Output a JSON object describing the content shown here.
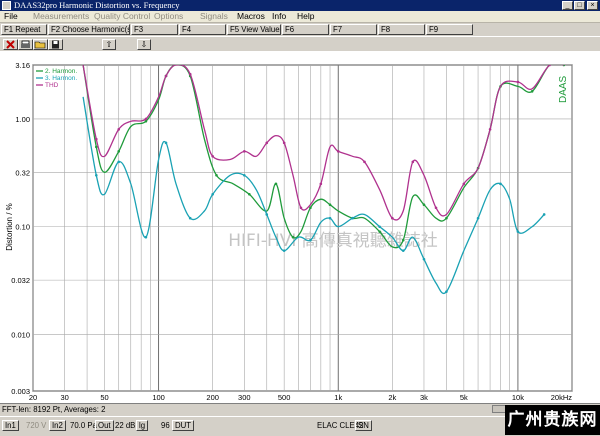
{
  "window": {
    "title": "DAAS32pro  Harmonic Distortion vs. Frequency",
    "min": "_",
    "max": "□",
    "close": "×"
  },
  "menu": [
    {
      "label": "File",
      "dim": false
    },
    {
      "label": "Measurements",
      "dim": true
    },
    {
      "label": "Quality Control",
      "dim": true
    },
    {
      "label": "Options",
      "dim": true
    },
    {
      "label": "Signals",
      "dim": true
    },
    {
      "label": "Macros",
      "dim": false
    },
    {
      "label": "Info",
      "dim": false
    },
    {
      "label": "Help",
      "dim": false
    }
  ],
  "fkeys": [
    "F1 Repeat",
    "F2 Choose Harmonic(s)",
    "F3",
    "F4",
    "F5 View Values",
    "F6",
    "F7",
    "F8",
    "F9"
  ],
  "toolbar": {
    "icons": [
      "delete-icon",
      "print-icon",
      "open-icon",
      "save-icon"
    ],
    "up": "⇧",
    "down": "⇩"
  },
  "chart_data": {
    "type": "line",
    "xscale": "log",
    "yscale": "log",
    "xlim": [
      20,
      20000
    ],
    "ylim": [
      0.003,
      3.16
    ],
    "ylabel": "Distortion / %",
    "yticks": [
      "3.16",
      "1.00",
      "0.32",
      "0.10",
      "0.032",
      "0.010",
      "0.003"
    ],
    "yticks_val": [
      3.16,
      1.0,
      0.32,
      0.1,
      0.032,
      0.01,
      0.003
    ],
    "xticks": [
      "20",
      "30",
      "50",
      "100",
      "200",
      "300",
      "500",
      "1k",
      "2k",
      "3k",
      "5k",
      "10k",
      "20kHz"
    ],
    "xticks_val": [
      20,
      30,
      50,
      100,
      200,
      300,
      500,
      1000,
      2000,
      3000,
      5000,
      10000,
      20000
    ],
    "watermark": "HIFI-HVI 高傳真視聽雜誌社",
    "corner_text": "DAAS",
    "legend": "top-left",
    "series": [
      {
        "name": "2. Harmon.",
        "color": "#1f9b3b",
        "x": [
          38,
          45,
          50,
          60,
          70,
          85,
          100,
          110,
          125,
          150,
          180,
          210,
          260,
          320,
          400,
          450,
          500,
          560,
          620,
          700,
          800,
          900,
          1000,
          1200,
          1400,
          1700,
          2000,
          2300,
          2600,
          3000,
          3500,
          4000,
          5000,
          6000,
          7000,
          8000,
          10000,
          12000,
          15000,
          18000
        ],
        "y": [
          3.16,
          0.55,
          0.32,
          0.5,
          0.85,
          0.95,
          1.5,
          2.5,
          3.16,
          2.5,
          0.65,
          0.3,
          0.25,
          0.2,
          0.14,
          0.25,
          0.12,
          0.08,
          0.09,
          0.15,
          0.18,
          0.16,
          0.14,
          0.12,
          0.12,
          0.09,
          0.065,
          0.075,
          0.19,
          0.16,
          0.12,
          0.12,
          0.23,
          0.35,
          0.8,
          2.0,
          2.0,
          1.8,
          3.16,
          3.16
        ]
      },
      {
        "name": "3. Harmon.",
        "color": "#1aa2b4",
        "x": [
          38,
          45,
          50,
          60,
          70,
          85,
          100,
          110,
          125,
          150,
          180,
          200,
          250,
          300,
          350,
          400,
          450,
          500,
          600,
          700,
          800,
          900,
          1000,
          1200,
          1400,
          1700,
          2000,
          2300,
          2600,
          3000,
          3500,
          4000,
          5000,
          6000,
          7000,
          8000,
          9000,
          10000,
          12000,
          14000
        ],
        "y": [
          1.6,
          0.3,
          0.2,
          0.4,
          0.25,
          0.08,
          0.42,
          0.6,
          0.25,
          0.12,
          0.14,
          0.2,
          0.3,
          0.3,
          0.22,
          0.13,
          0.08,
          0.06,
          0.08,
          0.075,
          0.11,
          0.12,
          0.1,
          0.12,
          0.13,
          0.1,
          0.08,
          0.06,
          0.08,
          0.05,
          0.03,
          0.025,
          0.06,
          0.12,
          0.22,
          0.25,
          0.18,
          0.09,
          0.1,
          0.13
        ]
      },
      {
        "name": "THD",
        "color": "#b0328e",
        "x": [
          38,
          45,
          50,
          60,
          70,
          85,
          100,
          110,
          125,
          150,
          180,
          200,
          250,
          300,
          350,
          400,
          450,
          500,
          560,
          620,
          700,
          800,
          900,
          1000,
          1200,
          1400,
          1700,
          2000,
          2300,
          2600,
          3000,
          3500,
          4000,
          5000,
          6000,
          7000,
          8000,
          10000,
          12000,
          15000,
          18000
        ],
        "y": [
          3.16,
          0.65,
          0.45,
          0.8,
          0.95,
          1.0,
          1.6,
          2.5,
          3.16,
          2.6,
          0.8,
          0.45,
          0.42,
          0.5,
          0.45,
          0.6,
          0.7,
          0.6,
          0.3,
          0.15,
          0.16,
          0.25,
          0.55,
          0.5,
          0.45,
          0.4,
          0.22,
          0.12,
          0.14,
          0.4,
          0.3,
          0.15,
          0.13,
          0.25,
          0.35,
          0.8,
          2.0,
          2.2,
          1.9,
          3.16,
          3.16
        ]
      }
    ]
  },
  "status": {
    "line1": "FFT-len: 8192 Pt, Averages: 2",
    "in1": "In1",
    "volts": "720 V",
    "in2": "In2",
    "pa": "70.0 Pa",
    "out": "Out",
    "db": "22 dB",
    "lg": "lg",
    "n96": "96",
    "dut": "DUT",
    "device": "ELAC CLE42",
    "sn": "SN",
    "brand": "广州贵族网"
  }
}
